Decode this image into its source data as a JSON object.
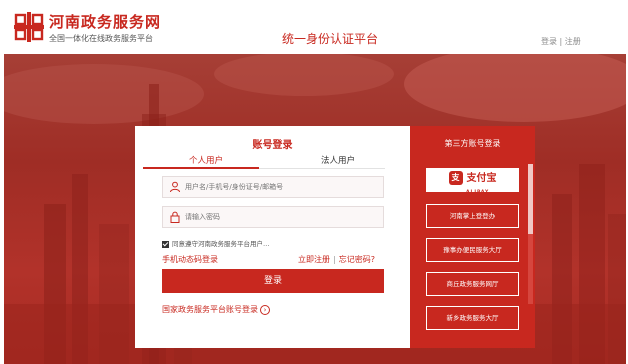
{
  "header": {
    "site_title": "河南政务服务网",
    "site_subtitle": "全国一体化在线政务服务平台",
    "center_title": "统一身份认证平台",
    "login_link": "登录",
    "divider": "|",
    "register_link": "注册"
  },
  "login": {
    "title": "账号登录",
    "tabs": [
      "个人用户",
      "法人用户"
    ],
    "username_placeholder": "用户名/手机号/身份证号/邮箱号",
    "password_placeholder": "请输入密码",
    "agreement": "同意遵守河南政务服务平台用户…",
    "sms_login": "手机动态码登录",
    "register": "立即注册",
    "forgot": "忘记密码?",
    "separator": "|",
    "login_button": "登录",
    "national_link": "国家政务服务平台账号登录"
  },
  "third_party": {
    "title": "第三方账号登录",
    "alipay_label": "支付宝",
    "alipay_sub": "ALIPAY",
    "alipay_icon": "支",
    "buttons": [
      "河南掌上登登办",
      "豫事办便民服务大厅",
      "商丘政务服务网厅",
      "新乡政务服务大厅"
    ]
  },
  "colors": {
    "brand_red": "#c8281f",
    "banner_red": "#a82a22"
  },
  "icons": {
    "logo": "logo-icon",
    "user": "user-icon",
    "lock": "lock-icon",
    "checkbox": "checkbox-icon",
    "arrow": "arrow-circle-icon",
    "alipay": "alipay-icon"
  }
}
